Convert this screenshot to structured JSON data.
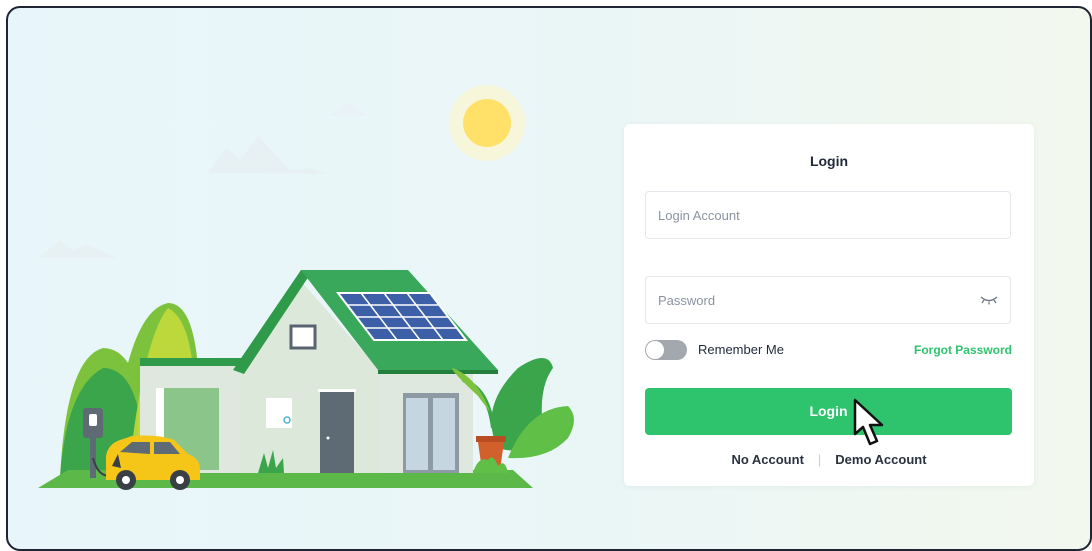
{
  "login": {
    "title": "Login",
    "account_placeholder": "Login Account",
    "password_placeholder": "Password",
    "remember_label": "Remember Me",
    "remember_on": false,
    "forgot_label": "Forgot Password",
    "button_label": "Login",
    "no_account_label": "No Account",
    "separator": "|",
    "demo_account_label": "Demo Account"
  },
  "icons": {
    "password_toggle": "eye-closed-icon",
    "cursor": "mouse-pointer-icon"
  },
  "colors": {
    "accent": "#2ec46e",
    "background": "#eaf6f8",
    "toggle_off": "#a3a8ae",
    "roof": "#2f9a4a",
    "car": "#f5c518"
  }
}
